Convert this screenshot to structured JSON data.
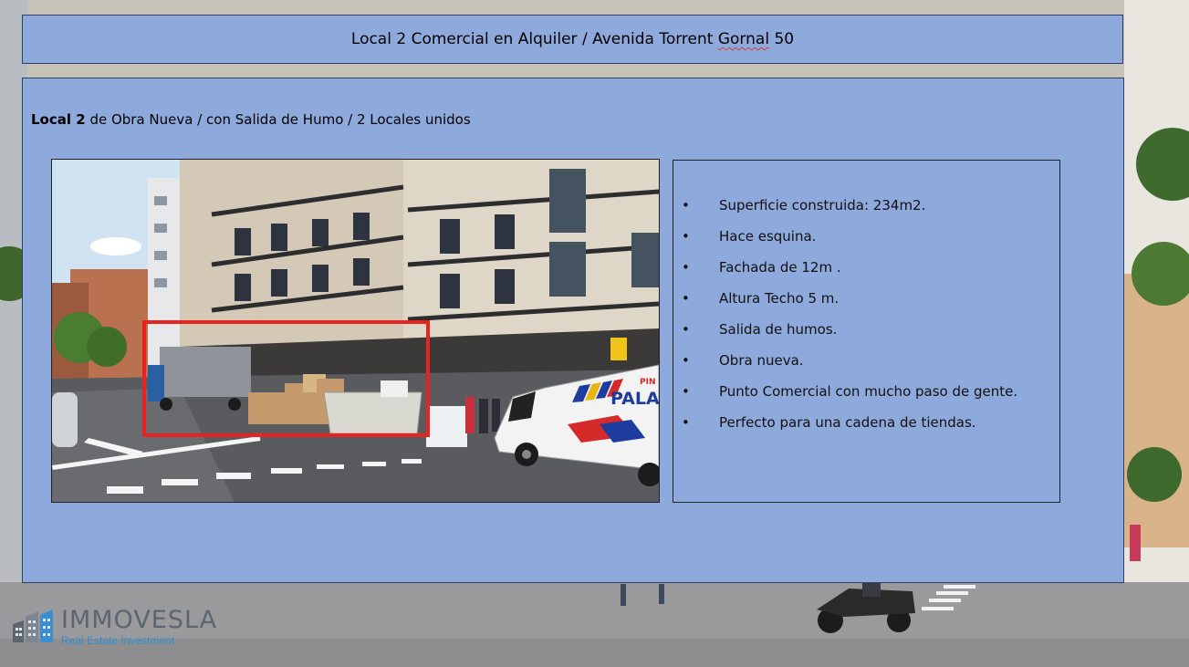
{
  "header": {
    "title_main": "Local 2 Comercial en Alquiler / Avenida Torrent ",
    "title_end": "Gornal",
    "title_num": " 50"
  },
  "panel": {
    "subtitle_bold": "Local 2",
    "subtitle_rest": " de Obra Nueva / con Salida de Humo / 2 Locales unidos"
  },
  "features": [
    "Superficie construida: 234m2.",
    "Hace esquina.",
    "Fachada de 12m .",
    "Altura Techo 5 m.",
    "Salida de humos.",
    "Obra nueva.",
    "Punto Comercial con mucho paso de gente.",
    "Perfecto para una cadena de tiendas."
  ],
  "bullet": "•",
  "photo": {
    "van_brand": "PALAC",
    "van_brand_prefix": "PIN",
    "highlight_color": "#e8231f"
  },
  "logo": {
    "name": "IMMOVESLA",
    "tagline": "Real Estate Investment",
    "icon": "building-logo-icon"
  },
  "colors": {
    "panel": "#8ea9db",
    "border": "#2f3e63",
    "logo_blue": "#2e8fd0"
  }
}
